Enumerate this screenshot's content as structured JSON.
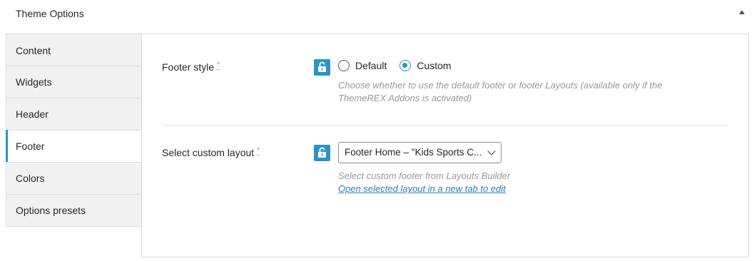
{
  "panel": {
    "title": "Theme Options"
  },
  "tabs": [
    {
      "label": "Content"
    },
    {
      "label": "Widgets"
    },
    {
      "label": "Header"
    },
    {
      "label": "Footer",
      "active": true
    },
    {
      "label": "Colors"
    },
    {
      "label": "Options presets"
    }
  ],
  "footer_style": {
    "label": "Footer style",
    "required_mark": "*",
    "options": [
      {
        "label": "Default",
        "checked": false
      },
      {
        "label": "Custom",
        "checked": true
      }
    ],
    "description_line1": "Choose whether to use the default footer or footer Layouts (available only if the",
    "description_line2": "ThemeREX Addons is activated)"
  },
  "custom_layout": {
    "label": "Select custom layout",
    "required_mark": "*",
    "selected_value": "Footer Home – \"Kids Sports C...",
    "description": "Select custom footer from Layouts Builder",
    "edit_link": "Open selected layout in a new tab to edit"
  },
  "colors": {
    "accent": "#2a95c5",
    "link": "#2a7fb8",
    "muted": "#999999"
  },
  "icons": {
    "lock": "unlock-icon",
    "collapse": "triangle-up-icon",
    "dropdown": "chevron-down-icon"
  }
}
